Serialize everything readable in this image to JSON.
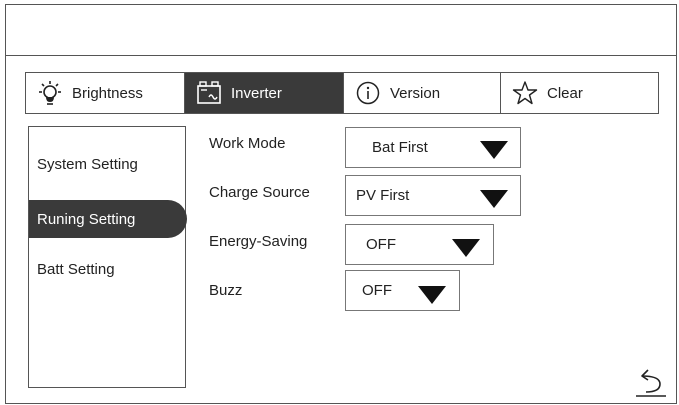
{
  "tabs": [
    {
      "label": "Brightness",
      "icon": "brightness-bulb-icon",
      "active": false
    },
    {
      "label": "Inverter",
      "icon": "inverter-icon",
      "active": true
    },
    {
      "label": "Version",
      "icon": "info-icon",
      "active": false
    },
    {
      "label": "Clear",
      "icon": "star-icon",
      "active": false
    }
  ],
  "sidebar": {
    "items": [
      {
        "label": "System Setting",
        "active": false
      },
      {
        "label": "Runing Setting",
        "active": true
      },
      {
        "label": "Batt Setting",
        "active": false
      }
    ]
  },
  "settings": [
    {
      "label": "Work Mode",
      "value": "Bat First"
    },
    {
      "label": "Charge Source",
      "value": "PV First"
    },
    {
      "label": "Energy-Saving",
      "value": "OFF"
    },
    {
      "label": "Buzz",
      "value": "OFF"
    }
  ],
  "colors": {
    "active_bg": "#3a3a3a",
    "border": "#555555",
    "text": "#222222"
  },
  "back_icon": "back-arrow-icon"
}
